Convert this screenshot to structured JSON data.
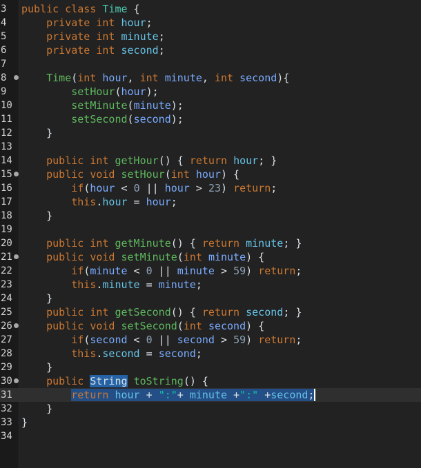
{
  "editor": {
    "lines": [
      {
        "n": "3",
        "indent": "",
        "tokens": [
          [
            "kw",
            "public"
          ],
          [
            "op",
            " "
          ],
          [
            "kw",
            "class"
          ],
          [
            "op",
            " "
          ],
          [
            "cls",
            "Time"
          ],
          [
            "op",
            " {"
          ]
        ]
      },
      {
        "n": "4",
        "indent": "    ",
        "tokens": [
          [
            "kw",
            "private"
          ],
          [
            "op",
            " "
          ],
          [
            "type",
            "int"
          ],
          [
            "op",
            " "
          ],
          [
            "fld",
            "hour"
          ],
          [
            "op",
            ";"
          ]
        ]
      },
      {
        "n": "5",
        "indent": "    ",
        "tokens": [
          [
            "kw",
            "private"
          ],
          [
            "op",
            " "
          ],
          [
            "type",
            "int"
          ],
          [
            "op",
            " "
          ],
          [
            "fld",
            "minute"
          ],
          [
            "op",
            ";"
          ]
        ]
      },
      {
        "n": "6",
        "indent": "    ",
        "tokens": [
          [
            "kw",
            "private"
          ],
          [
            "op",
            " "
          ],
          [
            "type",
            "int"
          ],
          [
            "op",
            " "
          ],
          [
            "fld",
            "second"
          ],
          [
            "op",
            ";"
          ]
        ]
      },
      {
        "n": "7",
        "indent": "",
        "tokens": []
      },
      {
        "n": "8",
        "marker": true,
        "indent": "    ",
        "tokens": [
          [
            "mth",
            "Time"
          ],
          [
            "op",
            "("
          ],
          [
            "type",
            "int"
          ],
          [
            "op",
            " "
          ],
          [
            "var",
            "hour"
          ],
          [
            "op",
            ", "
          ],
          [
            "type",
            "int"
          ],
          [
            "op",
            " "
          ],
          [
            "var",
            "minute"
          ],
          [
            "op",
            ", "
          ],
          [
            "type",
            "int"
          ],
          [
            "op",
            " "
          ],
          [
            "var",
            "second"
          ],
          [
            "op",
            "){"
          ]
        ]
      },
      {
        "n": "9",
        "indent": "        ",
        "tokens": [
          [
            "mth",
            "setHour"
          ],
          [
            "op",
            "("
          ],
          [
            "var",
            "hour"
          ],
          [
            "op",
            ");"
          ]
        ]
      },
      {
        "n": "10",
        "indent": "        ",
        "tokens": [
          [
            "mth",
            "setMinute"
          ],
          [
            "op",
            "("
          ],
          [
            "var",
            "minute"
          ],
          [
            "op",
            ");"
          ]
        ]
      },
      {
        "n": "11",
        "indent": "        ",
        "tokens": [
          [
            "mth",
            "setSecond"
          ],
          [
            "op",
            "("
          ],
          [
            "var",
            "second"
          ],
          [
            "op",
            ");"
          ]
        ]
      },
      {
        "n": "12",
        "indent": "    ",
        "tokens": [
          [
            "op",
            "}"
          ]
        ]
      },
      {
        "n": "13",
        "indent": "",
        "tokens": []
      },
      {
        "n": "14",
        "indent": "    ",
        "tokens": [
          [
            "kw",
            "public"
          ],
          [
            "op",
            " "
          ],
          [
            "type",
            "int"
          ],
          [
            "op",
            " "
          ],
          [
            "mth",
            "getHour"
          ],
          [
            "op",
            "() { "
          ],
          [
            "kw",
            "return"
          ],
          [
            "op",
            " "
          ],
          [
            "fld",
            "hour"
          ],
          [
            "op",
            "; }"
          ]
        ]
      },
      {
        "n": "15",
        "marker": true,
        "indent": "    ",
        "tokens": [
          [
            "kw",
            "public"
          ],
          [
            "op",
            " "
          ],
          [
            "type",
            "void"
          ],
          [
            "op",
            " "
          ],
          [
            "mth",
            "setHour"
          ],
          [
            "op",
            "("
          ],
          [
            "type",
            "int"
          ],
          [
            "op",
            " "
          ],
          [
            "var",
            "hour"
          ],
          [
            "op",
            ") {"
          ]
        ]
      },
      {
        "n": "16",
        "indent": "        ",
        "tokens": [
          [
            "kw",
            "if"
          ],
          [
            "op",
            "("
          ],
          [
            "var",
            "hour"
          ],
          [
            "op",
            " < "
          ],
          [
            "num",
            "0"
          ],
          [
            "op",
            " || "
          ],
          [
            "var",
            "hour"
          ],
          [
            "op",
            " > "
          ],
          [
            "num",
            "23"
          ],
          [
            "op",
            ") "
          ],
          [
            "kw",
            "return"
          ],
          [
            "op",
            ";"
          ]
        ]
      },
      {
        "n": "17",
        "indent": "        ",
        "tokens": [
          [
            "kw",
            "this"
          ],
          [
            "op",
            "."
          ],
          [
            "fld",
            "hour"
          ],
          [
            "op",
            " = "
          ],
          [
            "var",
            "hour"
          ],
          [
            "op",
            ";"
          ]
        ]
      },
      {
        "n": "18",
        "indent": "    ",
        "tokens": [
          [
            "op",
            "}"
          ]
        ]
      },
      {
        "n": "19",
        "indent": "",
        "tokens": []
      },
      {
        "n": "20",
        "indent": "    ",
        "tokens": [
          [
            "kw",
            "public"
          ],
          [
            "op",
            " "
          ],
          [
            "type",
            "int"
          ],
          [
            "op",
            " "
          ],
          [
            "mth",
            "getMinute"
          ],
          [
            "op",
            "() { "
          ],
          [
            "kw",
            "return"
          ],
          [
            "op",
            " "
          ],
          [
            "fld",
            "minute"
          ],
          [
            "op",
            "; }"
          ]
        ]
      },
      {
        "n": "21",
        "marker": true,
        "indent": "    ",
        "tokens": [
          [
            "kw",
            "public"
          ],
          [
            "op",
            " "
          ],
          [
            "type",
            "void"
          ],
          [
            "op",
            " "
          ],
          [
            "mth",
            "setMinute"
          ],
          [
            "op",
            "("
          ],
          [
            "type",
            "int"
          ],
          [
            "op",
            " "
          ],
          [
            "var",
            "minute"
          ],
          [
            "op",
            ") {"
          ]
        ]
      },
      {
        "n": "22",
        "indent": "        ",
        "tokens": [
          [
            "kw",
            "if"
          ],
          [
            "op",
            "("
          ],
          [
            "var",
            "minute"
          ],
          [
            "op",
            " < "
          ],
          [
            "num",
            "0"
          ],
          [
            "op",
            " || "
          ],
          [
            "var",
            "minute"
          ],
          [
            "op",
            " > "
          ],
          [
            "num",
            "59"
          ],
          [
            "op",
            ") "
          ],
          [
            "kw",
            "return"
          ],
          [
            "op",
            ";"
          ]
        ]
      },
      {
        "n": "23",
        "indent": "        ",
        "tokens": [
          [
            "kw",
            "this"
          ],
          [
            "op",
            "."
          ],
          [
            "fld",
            "minute"
          ],
          [
            "op",
            " = "
          ],
          [
            "var",
            "minute"
          ],
          [
            "op",
            ";"
          ]
        ]
      },
      {
        "n": "24",
        "indent": "    ",
        "tokens": [
          [
            "op",
            "}"
          ]
        ]
      },
      {
        "n": "25",
        "indent": "    ",
        "tokens": [
          [
            "kw",
            "public"
          ],
          [
            "op",
            " "
          ],
          [
            "type",
            "int"
          ],
          [
            "op",
            " "
          ],
          [
            "mth",
            "getSecond"
          ],
          [
            "op",
            "() { "
          ],
          [
            "kw",
            "return"
          ],
          [
            "op",
            " "
          ],
          [
            "fld",
            "second"
          ],
          [
            "op",
            "; }"
          ]
        ]
      },
      {
        "n": "26",
        "marker": true,
        "indent": "    ",
        "tokens": [
          [
            "kw",
            "public"
          ],
          [
            "op",
            " "
          ],
          [
            "type",
            "void"
          ],
          [
            "op",
            " "
          ],
          [
            "mth",
            "setSecond"
          ],
          [
            "op",
            "("
          ],
          [
            "type",
            "int"
          ],
          [
            "op",
            " "
          ],
          [
            "var",
            "second"
          ],
          [
            "op",
            ") {"
          ]
        ]
      },
      {
        "n": "27",
        "indent": "        ",
        "tokens": [
          [
            "kw",
            "if"
          ],
          [
            "op",
            "("
          ],
          [
            "var",
            "second"
          ],
          [
            "op",
            " < "
          ],
          [
            "num",
            "0"
          ],
          [
            "op",
            " || "
          ],
          [
            "var",
            "second"
          ],
          [
            "op",
            " > "
          ],
          [
            "num",
            "59"
          ],
          [
            "op",
            ") "
          ],
          [
            "kw",
            "return"
          ],
          [
            "op",
            ";"
          ]
        ]
      },
      {
        "n": "28",
        "indent": "        ",
        "tokens": [
          [
            "kw",
            "this"
          ],
          [
            "op",
            "."
          ],
          [
            "fld",
            "second"
          ],
          [
            "op",
            " = "
          ],
          [
            "var",
            "second"
          ],
          [
            "op",
            ";"
          ]
        ]
      },
      {
        "n": "29",
        "indent": "    ",
        "tokens": [
          [
            "op",
            "}"
          ]
        ]
      },
      {
        "n": "30",
        "marker": true,
        "indent": "    ",
        "tokens": [
          [
            "kw",
            "public"
          ],
          [
            "op",
            " "
          ],
          [
            "selbox",
            "String"
          ],
          [
            "op",
            " "
          ],
          [
            "mth",
            "toString"
          ],
          [
            "op",
            "() {"
          ]
        ]
      },
      {
        "n": "31",
        "current": true,
        "indent": "        ",
        "tokens": [
          [
            "sel kw",
            "return"
          ],
          [
            "sel op",
            " "
          ],
          [
            "sel fld",
            "hour"
          ],
          [
            "sel op",
            " + "
          ],
          [
            "sel str",
            "\":\""
          ],
          [
            "sel op",
            "+ "
          ],
          [
            "sel fld",
            "minute"
          ],
          [
            "sel op",
            " +"
          ],
          [
            "sel str",
            "\":\""
          ],
          [
            "sel op",
            " +"
          ],
          [
            "sel fld",
            "second"
          ],
          [
            "sel op caret",
            ";"
          ]
        ]
      },
      {
        "n": "32",
        "indent": "    ",
        "tokens": [
          [
            "op",
            "}"
          ]
        ]
      },
      {
        "n": "33",
        "indent": "",
        "tokens": [
          [
            "op",
            "}"
          ]
        ]
      },
      {
        "n": "34",
        "indent": "",
        "tokens": []
      }
    ]
  }
}
